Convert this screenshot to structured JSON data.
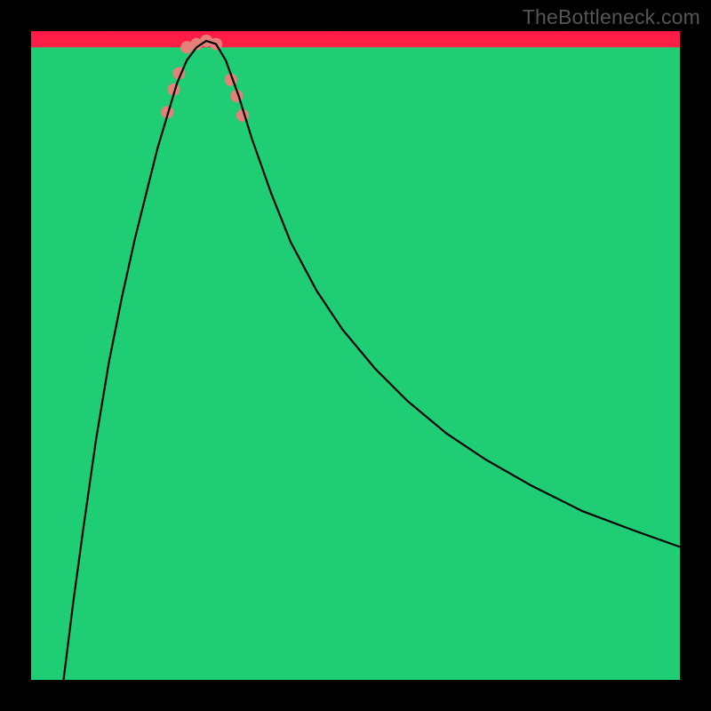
{
  "watermark": "TheBottleneck.com",
  "chart_data": {
    "type": "line",
    "title": "",
    "xlabel": "",
    "ylabel": "",
    "xlim": [
      0,
      100
    ],
    "ylim": [
      0,
      100
    ],
    "grid": false,
    "background_gradient": {
      "stops": [
        {
          "offset": 0.0,
          "color": "#ff1a46"
        },
        {
          "offset": 0.15,
          "color": "#ff3e3e"
        },
        {
          "offset": 0.32,
          "color": "#ff7a2a"
        },
        {
          "offset": 0.5,
          "color": "#ffb61e"
        },
        {
          "offset": 0.66,
          "color": "#ffe81a"
        },
        {
          "offset": 0.8,
          "color": "#fbff3a"
        },
        {
          "offset": 0.86,
          "color": "#f5ffb0"
        },
        {
          "offset": 0.9,
          "color": "#d8ffb8"
        },
        {
          "offset": 0.94,
          "color": "#80ff8c"
        },
        {
          "offset": 0.97,
          "color": "#26e484"
        },
        {
          "offset": 1.0,
          "color": "#18c86e"
        }
      ]
    },
    "green_band": {
      "y_top": 97.5,
      "y_bottom": 100
    },
    "series": [
      {
        "name": "curve",
        "color": "#000000",
        "width": 2.2,
        "x": [
          5.0,
          6.5,
          8.0,
          10.0,
          12.0,
          14.0,
          16.0,
          18.0,
          19.5,
          21.0,
          22.5,
          24.0,
          25.5,
          27.0,
          28.5,
          30.0,
          32.0,
          34.0,
          37.0,
          40.0,
          44.0,
          48.0,
          53.0,
          58.0,
          64.0,
          70.0,
          77.0,
          85.0,
          93.0,
          100.0
        ],
        "y": [
          0.0,
          12.0,
          23.0,
          37.0,
          49.0,
          59.0,
          68.0,
          76.0,
          82.0,
          87.0,
          92.0,
          95.5,
          97.5,
          98.5,
          98.0,
          95.5,
          90.0,
          83.5,
          75.0,
          67.5,
          60.0,
          54.0,
          48.0,
          43.0,
          38.0,
          34.0,
          30.0,
          26.0,
          23.0,
          20.5
        ]
      }
    ],
    "markers": {
      "color": "#e6817a",
      "radius": 7,
      "points": [
        {
          "x": 21.0,
          "y": 87.5
        },
        {
          "x": 22.0,
          "y": 91.0
        },
        {
          "x": 22.8,
          "y": 93.5
        },
        {
          "x": 24.0,
          "y": 97.5
        },
        {
          "x": 25.5,
          "y": 98.0
        },
        {
          "x": 27.0,
          "y": 98.5
        },
        {
          "x": 28.5,
          "y": 98.0
        },
        {
          "x": 30.8,
          "y": 92.5
        },
        {
          "x": 31.7,
          "y": 90.0
        },
        {
          "x": 32.6,
          "y": 87.0
        }
      ]
    }
  }
}
